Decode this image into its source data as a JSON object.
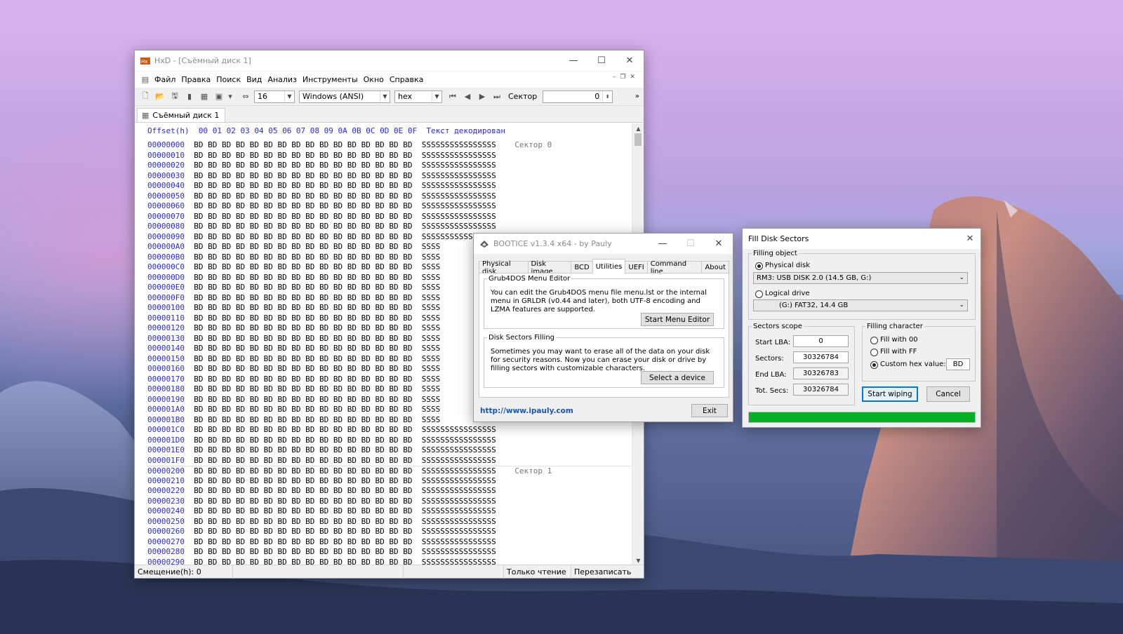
{
  "hxd": {
    "title": "HxD - [Съёмный диск 1]",
    "menu": [
      "Файл",
      "Правка",
      "Поиск",
      "Вид",
      "Анализ",
      "Инструменты",
      "Окно",
      "Справка"
    ],
    "toolbar": {
      "bytes_per_row": "16",
      "charset": "Windows (ANSI)",
      "offset_base": "hex",
      "sector_label": "Сектор",
      "sector_value": "0"
    },
    "tab": "Съёмный диск 1",
    "header": {
      "offset_label": "Offset(h)",
      "columns": "00 01 02 03 04 05 06 07 08 09 0A 0B 0C 0D 0E 0F",
      "text_label": "Текст декодирован"
    },
    "rows": [
      {
        "off": "00000000",
        "bytes": "BD BD BD BD BD BD BD BD BD BD BD BD BD BD BD BD",
        "text": "SSSSSSSSSSSSSSSS",
        "note": "Сектор 0"
      },
      {
        "off": "00000010",
        "bytes": "BD BD BD BD BD BD BD BD BD BD BD BD BD BD BD BD",
        "text": "SSSSSSSSSSSSSSSS",
        "note": ""
      },
      {
        "off": "00000020",
        "bytes": "BD BD BD BD BD BD BD BD BD BD BD BD BD BD BD BD",
        "text": "SSSSSSSSSSSSSSSS",
        "note": ""
      },
      {
        "off": "00000030",
        "bytes": "BD BD BD BD BD BD BD BD BD BD BD BD BD BD BD BD",
        "text": "SSSSSSSSSSSSSSSS",
        "note": ""
      },
      {
        "off": "00000040",
        "bytes": "BD BD BD BD BD BD BD BD BD BD BD BD BD BD BD BD",
        "text": "SSSSSSSSSSSSSSSS",
        "note": ""
      },
      {
        "off": "00000050",
        "bytes": "BD BD BD BD BD BD BD BD BD BD BD BD BD BD BD BD",
        "text": "SSSSSSSSSSSSSSSS",
        "note": ""
      },
      {
        "off": "00000060",
        "bytes": "BD BD BD BD BD BD BD BD BD BD BD BD BD BD BD BD",
        "text": "SSSSSSSSSSSSSSSS",
        "note": ""
      },
      {
        "off": "00000070",
        "bytes": "BD BD BD BD BD BD BD BD BD BD BD BD BD BD BD BD",
        "text": "SSSSSSSSSSSSSSSS",
        "note": ""
      },
      {
        "off": "00000080",
        "bytes": "BD BD BD BD BD BD BD BD BD BD BD BD BD BD BD BD",
        "text": "SSSSSSSSSSSSSSSS",
        "note": ""
      },
      {
        "off": "00000090",
        "bytes": "BD BD BD BD BD BD BD BD BD BD BD BD BD BD BD BD",
        "text": "SSSSSSSSSSSSSSSS",
        "note": ""
      },
      {
        "off": "000000A0",
        "bytes": "BD BD BD BD BD BD BD BD BD BD BD BD BD BD BD BD",
        "text": "SSSS",
        "note": ""
      },
      {
        "off": "000000B0",
        "bytes": "BD BD BD BD BD BD BD BD BD BD BD BD BD BD BD BD",
        "text": "SSSS",
        "note": ""
      },
      {
        "off": "000000C0",
        "bytes": "BD BD BD BD BD BD BD BD BD BD BD BD BD BD BD BD",
        "text": "SSSS",
        "note": ""
      },
      {
        "off": "000000D0",
        "bytes": "BD BD BD BD BD BD BD BD BD BD BD BD BD BD BD BD",
        "text": "SSSS",
        "note": ""
      },
      {
        "off": "000000E0",
        "bytes": "BD BD BD BD BD BD BD BD BD BD BD BD BD BD BD BD",
        "text": "SSSS",
        "note": ""
      },
      {
        "off": "000000F0",
        "bytes": "BD BD BD BD BD BD BD BD BD BD BD BD BD BD BD BD",
        "text": "SSSS",
        "note": ""
      },
      {
        "off": "00000100",
        "bytes": "BD BD BD BD BD BD BD BD BD BD BD BD BD BD BD BD",
        "text": "SSSS",
        "note": ""
      },
      {
        "off": "00000110",
        "bytes": "BD BD BD BD BD BD BD BD BD BD BD BD BD BD BD BD",
        "text": "SSSS",
        "note": ""
      },
      {
        "off": "00000120",
        "bytes": "BD BD BD BD BD BD BD BD BD BD BD BD BD BD BD BD",
        "text": "SSSS",
        "note": ""
      },
      {
        "off": "00000130",
        "bytes": "BD BD BD BD BD BD BD BD BD BD BD BD BD BD BD BD",
        "text": "SSSS",
        "note": ""
      },
      {
        "off": "00000140",
        "bytes": "BD BD BD BD BD BD BD BD BD BD BD BD BD BD BD BD",
        "text": "SSSS",
        "note": ""
      },
      {
        "off": "00000150",
        "bytes": "BD BD BD BD BD BD BD BD BD BD BD BD BD BD BD BD",
        "text": "SSSS",
        "note": ""
      },
      {
        "off": "00000160",
        "bytes": "BD BD BD BD BD BD BD BD BD BD BD BD BD BD BD BD",
        "text": "SSSS",
        "note": ""
      },
      {
        "off": "00000170",
        "bytes": "BD BD BD BD BD BD BD BD BD BD BD BD BD BD BD BD",
        "text": "SSSS",
        "note": ""
      },
      {
        "off": "00000180",
        "bytes": "BD BD BD BD BD BD BD BD BD BD BD BD BD BD BD BD",
        "text": "SSSS",
        "note": ""
      },
      {
        "off": "00000190",
        "bytes": "BD BD BD BD BD BD BD BD BD BD BD BD BD BD BD BD",
        "text": "SSSS",
        "note": ""
      },
      {
        "off": "000001A0",
        "bytes": "BD BD BD BD BD BD BD BD BD BD BD BD BD BD BD BD",
        "text": "SSSS",
        "note": ""
      },
      {
        "off": "000001B0",
        "bytes": "BD BD BD BD BD BD BD BD BD BD BD BD BD BD BD BD",
        "text": "SSSS",
        "note": ""
      },
      {
        "off": "000001C0",
        "bytes": "BD BD BD BD BD BD BD BD BD BD BD BD BD BD BD BD",
        "text": "SSSSSSSSSSSSSSSS",
        "note": ""
      },
      {
        "off": "000001D0",
        "bytes": "BD BD BD BD BD BD BD BD BD BD BD BD BD BD BD BD",
        "text": "SSSSSSSSSSSSSSSS",
        "note": ""
      },
      {
        "off": "000001E0",
        "bytes": "BD BD BD BD BD BD BD BD BD BD BD BD BD BD BD BD",
        "text": "SSSSSSSSSSSSSSSS",
        "note": ""
      },
      {
        "off": "000001F0",
        "bytes": "BD BD BD BD BD BD BD BD BD BD BD BD BD BD BD BD",
        "text": "SSSSSSSSSSSSSSSS",
        "note": ""
      },
      {
        "off": "00000200",
        "bytes": "BD BD BD BD BD BD BD BD BD BD BD BD BD BD BD BD",
        "text": "SSSSSSSSSSSSSSSS",
        "note": "Сектор 1"
      },
      {
        "off": "00000210",
        "bytes": "BD BD BD BD BD BD BD BD BD BD BD BD BD BD BD BD",
        "text": "SSSSSSSSSSSSSSSS",
        "note": ""
      },
      {
        "off": "00000220",
        "bytes": "BD BD BD BD BD BD BD BD BD BD BD BD BD BD BD BD",
        "text": "SSSSSSSSSSSSSSSS",
        "note": ""
      },
      {
        "off": "00000230",
        "bytes": "BD BD BD BD BD BD BD BD BD BD BD BD BD BD BD BD",
        "text": "SSSSSSSSSSSSSSSS",
        "note": ""
      },
      {
        "off": "00000240",
        "bytes": "BD BD BD BD BD BD BD BD BD BD BD BD BD BD BD BD",
        "text": "SSSSSSSSSSSSSSSS",
        "note": ""
      },
      {
        "off": "00000250",
        "bytes": "BD BD BD BD BD BD BD BD BD BD BD BD BD BD BD BD",
        "text": "SSSSSSSSSSSSSSSS",
        "note": ""
      },
      {
        "off": "00000260",
        "bytes": "BD BD BD BD BD BD BD BD BD BD BD BD BD BD BD BD",
        "text": "SSSSSSSSSSSSSSSS",
        "note": ""
      },
      {
        "off": "00000270",
        "bytes": "BD BD BD BD BD BD BD BD BD BD BD BD BD BD BD BD",
        "text": "SSSSSSSSSSSSSSSS",
        "note": ""
      },
      {
        "off": "00000280",
        "bytes": "BD BD BD BD BD BD BD BD BD BD BD BD BD BD BD BD",
        "text": "SSSSSSSSSSSSSSSS",
        "note": ""
      },
      {
        "off": "00000290",
        "bytes": "BD BD BD BD BD BD BD BD BD BD BD BD BD BD BD BD",
        "text": "SSSSSSSSSSSSSSSS",
        "note": ""
      }
    ],
    "status": {
      "offset": "Смещение(h): 0",
      "mode": "Только чтение",
      "overwrite": "Перезаписать"
    }
  },
  "bootice": {
    "title": "BOOTICE v1.3.4 x64 - by Pauly",
    "tabs": [
      "Physical disk",
      "Disk image",
      "BCD",
      "Utilities",
      "UEFI",
      "Command line",
      "About"
    ],
    "selected_tab": "Utilities",
    "grub": {
      "legend": "Grub4DOS Menu Editor",
      "text": "You can edit the Grub4DOS menu file menu.lst or the internal menu in GRLDR (v0.44 and later), both UTF-8 encoding and LZMA features are supported.",
      "button": "Start Menu Editor"
    },
    "fill": {
      "legend": "Disk Sectors Filling",
      "text": "Sometimes you may want to erase all of the data on your disk for security reasons. Now you can erase your disk or drive by filling sectors with customizable characters.",
      "button": "Select a device"
    },
    "link": "http://www.ipauly.com",
    "exit": "Exit"
  },
  "fill_dialog": {
    "title": "Fill Disk Sectors",
    "filling_object": "Filling object",
    "physical_disk": "Physical disk",
    "physical_value": "RM3: USB DISK 2.0 (14.5 GB, G:)",
    "logical_drive": "Logical drive",
    "logical_value": "(G:) FAT32,  14.4 GB",
    "scope": {
      "legend": "Sectors scope",
      "start_lba_label": "Start LBA:",
      "start_lba": "0",
      "sectors_label": "Sectors:",
      "sectors": "30326784",
      "end_lba_label": "End LBA:",
      "end_lba": "30326783",
      "tot_label": "Tot. Secs:",
      "tot": "30326784"
    },
    "charset": {
      "legend": "Filling character",
      "fill00": "Fill with 00",
      "fillff": "Fill with FF",
      "custom": "Custom hex value:",
      "custom_value": "BD"
    },
    "start": "Start wiping",
    "cancel": "Cancel",
    "progress": 1.0,
    "progress_color": "#06b025"
  }
}
